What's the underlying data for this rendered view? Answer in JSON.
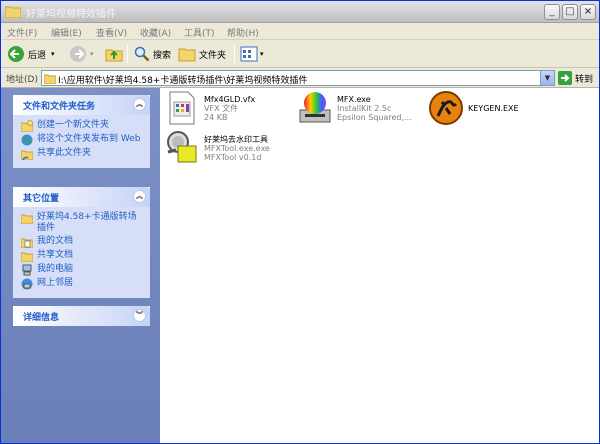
{
  "window": {
    "title": "好莱坞视频特效插件"
  },
  "menu": [
    "文件(F)",
    "编辑(E)",
    "查看(V)",
    "收藏(A)",
    "工具(T)",
    "帮助(H)"
  ],
  "toolbar": {
    "back": "后退",
    "search": "搜索",
    "folders": "文件夹"
  },
  "address": {
    "label": "地址(D)",
    "path": "I:\\应用软件\\好莱坞4.58+卡通版转场插件\\好莱坞视频特效插件",
    "go": "转到"
  },
  "sidebar": {
    "tasks": {
      "title": "文件和文件夹任务",
      "items": [
        "创建一个新文件夹",
        "将这个文件夹发布到 Web",
        "共享此文件夹"
      ]
    },
    "places": {
      "title": "其它位置",
      "items": [
        "好莱坞4.58+卡通版转场插件",
        "我的文档",
        "共享文档",
        "我的电脑",
        "网上邻居"
      ]
    },
    "details": {
      "title": "详细信息"
    }
  },
  "files": [
    {
      "name": "Mfx4GLD.vfx",
      "line2": "VFX 文件",
      "line3": "24 KB"
    },
    {
      "name": "MFX.exe",
      "line2": "InstallKit 2.5c",
      "line3": "Epsilon Squared,..."
    },
    {
      "name": "KEYGEN.EXE",
      "line2": "",
      "line3": ""
    },
    {
      "name": "好莱坞去水印工具",
      "line2": "MFXTool.exe.exe",
      "line3": "MFXTool v0.1d"
    }
  ]
}
